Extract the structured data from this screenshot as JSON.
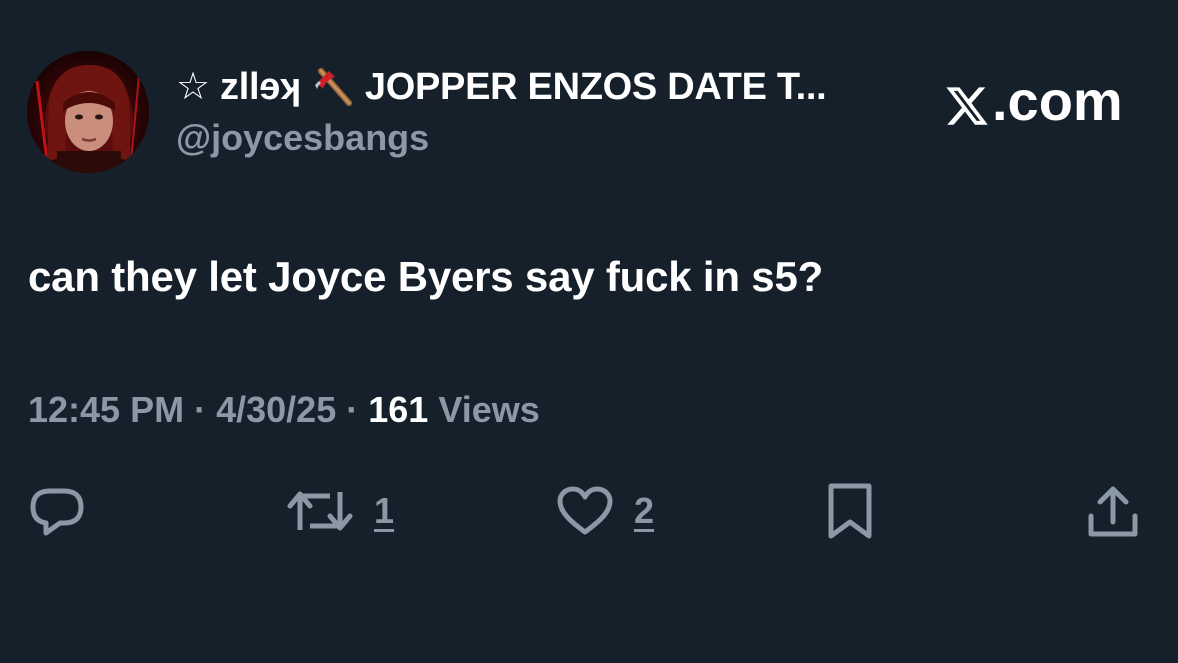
{
  "author": {
    "display_name_prefix": "☆ zllɘʞ",
    "display_name_suffix": "JOPPER ENZOS DATE T...",
    "handle": "@joycesbangs",
    "avatar_icon": "profile-photo"
  },
  "brand": {
    "text": ".com",
    "logo_icon": "x-logo-icon"
  },
  "tweet": {
    "text": "can they let Joyce Byers say fuck in s5?"
  },
  "meta": {
    "time": "12:45 PM",
    "separator": "·",
    "date": "4/30/25",
    "views_count": "161",
    "views_label": "Views"
  },
  "actions": {
    "reply_icon": "reply-icon",
    "retweet_icon": "retweet-icon",
    "retweet_count": "1",
    "like_icon": "heart-icon",
    "like_count": "2",
    "bookmark_icon": "bookmark-icon",
    "share_icon": "share-icon"
  },
  "colors": {
    "background": "#15202b",
    "text_primary": "#ffffff",
    "text_secondary": "#8b98a5"
  }
}
